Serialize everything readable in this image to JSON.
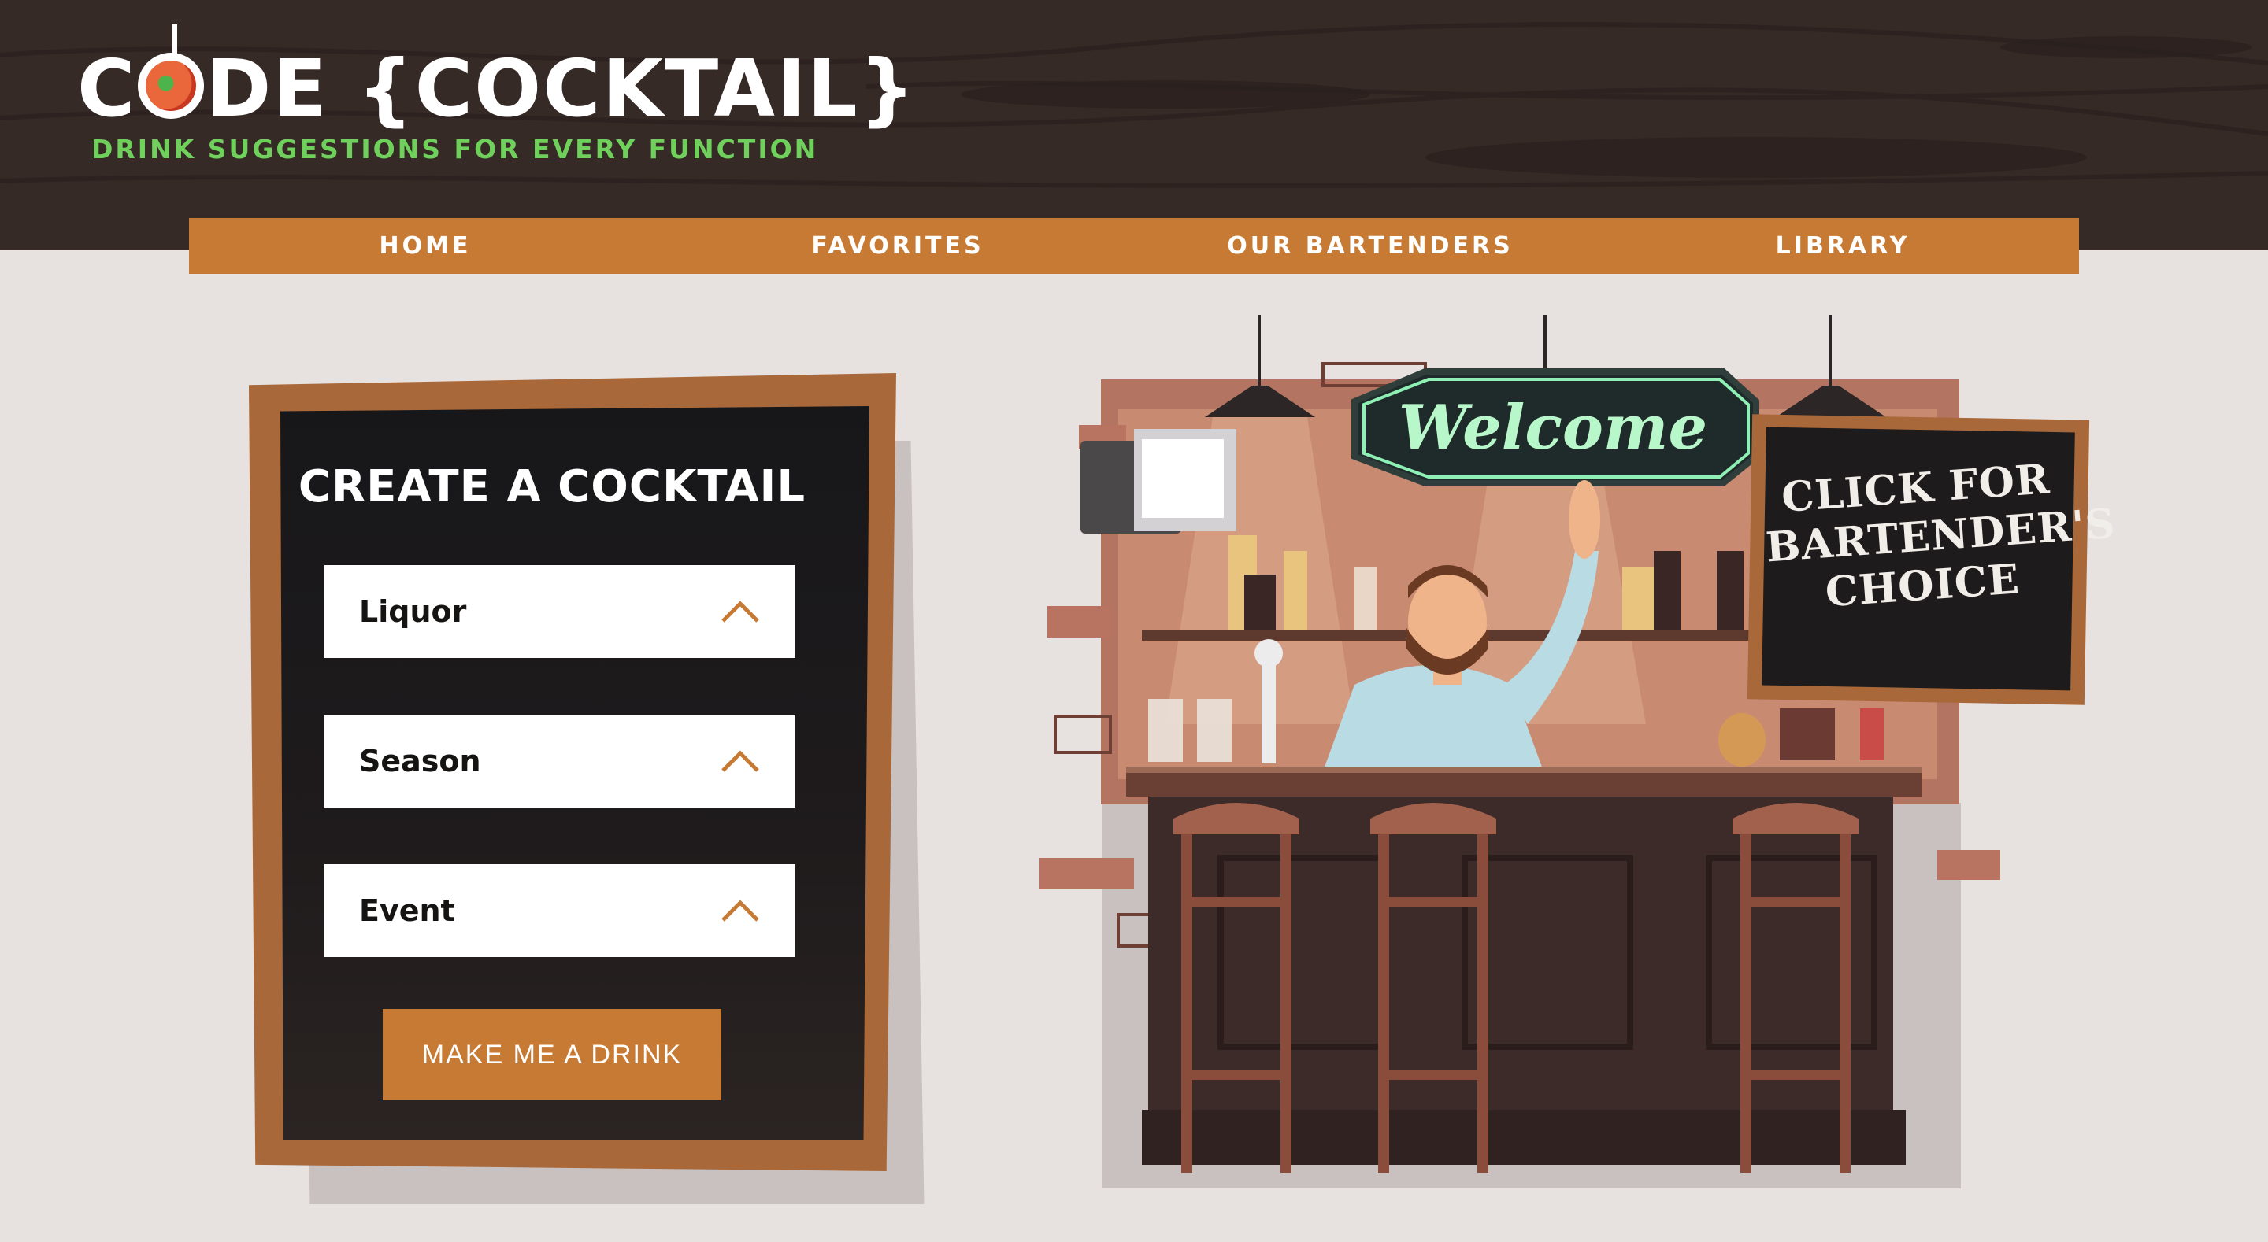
{
  "header": {
    "logo_title": "C DE {COCKTAIL}",
    "logo_title_before": "C",
    "logo_title_after": "DE {COCKTAIL}",
    "tagline": "DRINK SUGGESTIONS FOR EVERY FUNCTION",
    "logo_icon": "cocktail-glass-icon"
  },
  "nav": {
    "items": [
      {
        "label": "HOME"
      },
      {
        "label": "FAVORITES"
      },
      {
        "label": "OUR BARTENDERS"
      },
      {
        "label": "LIBRARY"
      }
    ]
  },
  "create_panel": {
    "title": "CREATE A COCKTAIL",
    "selects": [
      {
        "label": "Liquor",
        "icon": "chevron-up-icon"
      },
      {
        "label": "Season",
        "icon": "chevron-up-icon"
      },
      {
        "label": "Event",
        "icon": "chevron-up-icon"
      }
    ],
    "button_label": "MAKE ME A DRINK"
  },
  "illustration": {
    "welcome_sign": "Welcome",
    "choice_sign_lines": [
      "CLICK FOR",
      "BARTENDER'S",
      "CHOICE"
    ]
  },
  "colors": {
    "header_bg": "#362a26",
    "accent_orange": "#c77a34",
    "tagline_green": "#6fd15b",
    "page_bg": "#e7e1df",
    "chalkboard": "#1d1b1c",
    "frame_wood": "#a9683a"
  }
}
